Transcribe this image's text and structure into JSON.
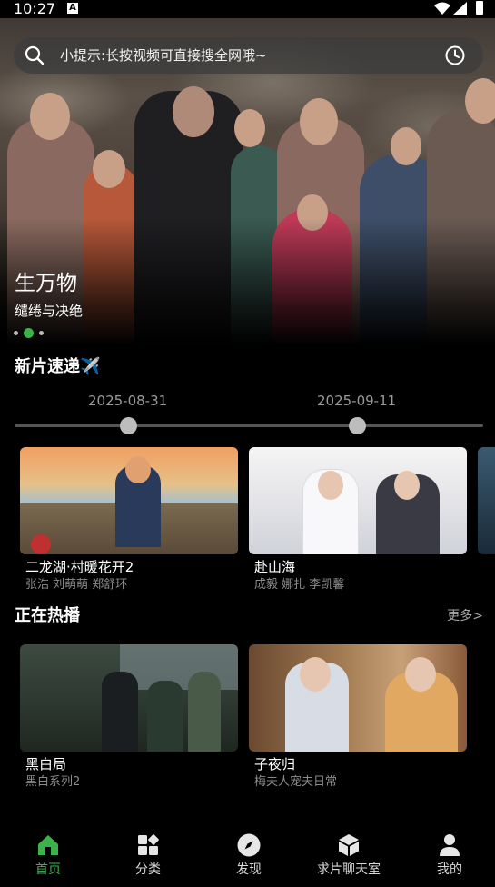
{
  "status_bar": {
    "time": "10:27"
  },
  "search": {
    "hint": "小提示:长按视频可直接搜全网哦~"
  },
  "hero": {
    "title": "生万物",
    "subtitle": "缱绻与决绝",
    "slide_count": 3,
    "active_slide": 2
  },
  "new_releases": {
    "title": "新片速递✈️",
    "timeline": [
      {
        "date": "2025-08-31"
      },
      {
        "date": "2025-09-11"
      }
    ],
    "items": [
      {
        "title": "二龙湖·村暖花开2",
        "subtitle": "张浩 刘萌萌 郑舒环"
      },
      {
        "title": "赴山海",
        "subtitle": "成毅 娜扎 李凯馨"
      }
    ]
  },
  "now_playing": {
    "title": "正在热播",
    "more_label": "更多>",
    "items": [
      {
        "title": "黑白局",
        "subtitle": "黑白系列2"
      },
      {
        "title": "子夜归",
        "subtitle": "梅夫人宠夫日常"
      }
    ]
  },
  "bottom_nav": {
    "active_color": "#3cb34a",
    "items": [
      {
        "label": "首页",
        "icon": "home-icon",
        "active": true
      },
      {
        "label": "分类",
        "icon": "category-icon",
        "active": false
      },
      {
        "label": "发现",
        "icon": "compass-icon",
        "active": false
      },
      {
        "label": "求片聊天室",
        "icon": "cube-icon",
        "active": false
      },
      {
        "label": "我的",
        "icon": "profile-icon",
        "active": false
      }
    ]
  }
}
